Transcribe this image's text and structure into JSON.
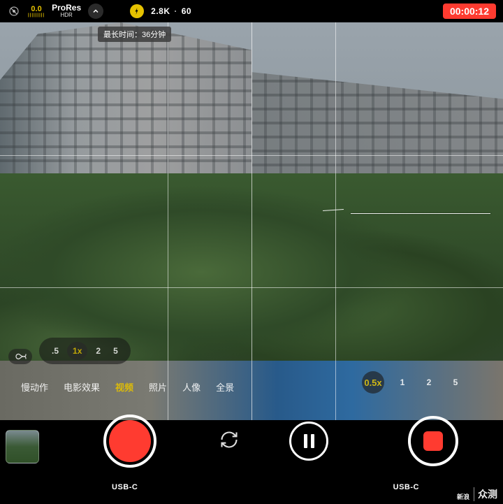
{
  "topbar": {
    "exposure_value": "0.0",
    "codec": "ProRes",
    "codec_sub": "HDR",
    "resolution": "2.8K",
    "fps": "60"
  },
  "timer": "00:00:12",
  "max_time_label": "最长时间：36分钟",
  "zoom_left": {
    "z05": ".5",
    "z1": "1x",
    "z2": "2",
    "z5": "5"
  },
  "zoom_right": {
    "z05": "0.5x",
    "z1": "1",
    "z2": "2",
    "z5": "5"
  },
  "modes": {
    "slowmo": "慢动作",
    "cinematic": "电影效果",
    "video": "视频",
    "photo": "照片",
    "portrait": "人像",
    "pano": "全景"
  },
  "bottom": {
    "usb_left": "USB-C",
    "usb_right": "USB-C"
  },
  "watermark": {
    "brand_small": "新浪",
    "brand": "众测"
  },
  "icons": {
    "settings": "settings-icon",
    "chevron_up": "chevron-up-icon",
    "action": "action-mode-icon",
    "infinity": "infinity-icon",
    "flip": "camera-flip-icon"
  }
}
